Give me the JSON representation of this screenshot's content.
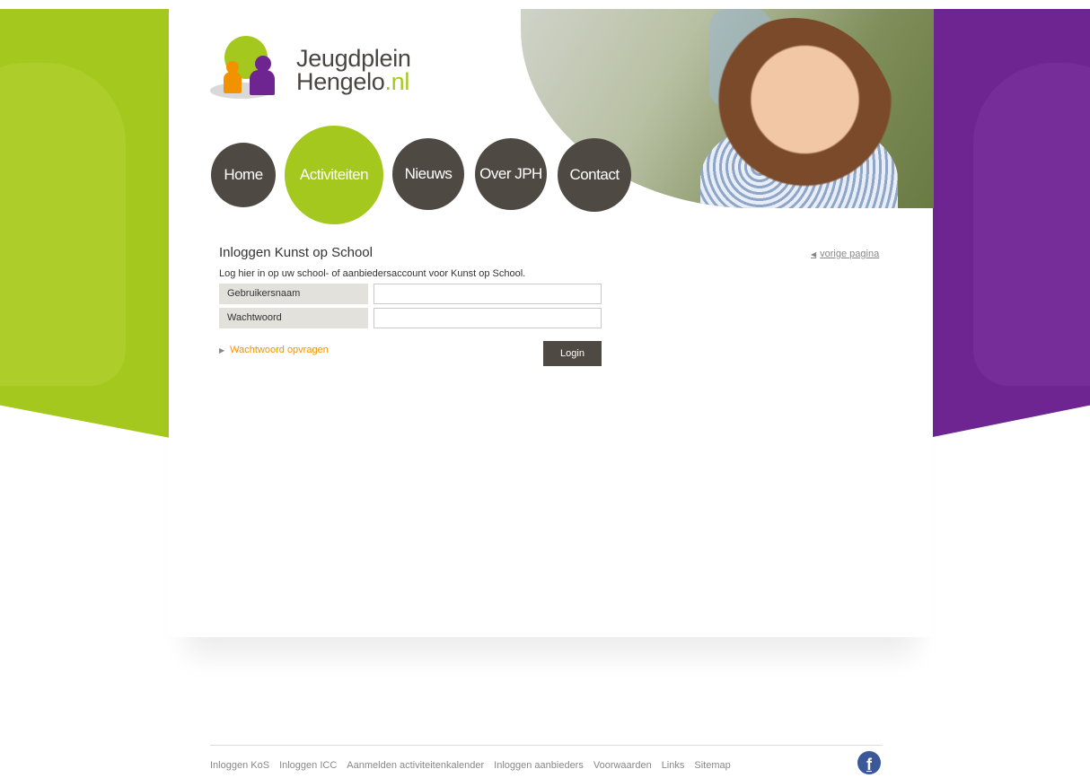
{
  "brand": {
    "line1": "Jeugdplein",
    "line2_main": "Hengelo",
    "line2_suffix": ".nl",
    "colors": {
      "green": "#a5c81e",
      "purple": "#6e2592",
      "dark": "#4f4944",
      "orange": "#f39200"
    }
  },
  "nav": {
    "items": [
      {
        "label": "Home",
        "active": false
      },
      {
        "label": "Activiteiten",
        "active": true
      },
      {
        "label": "Nieuws",
        "active": false
      },
      {
        "label": "Over JPH",
        "active": false
      },
      {
        "label": "Contact",
        "active": false
      }
    ]
  },
  "page": {
    "title": "Inloggen Kunst op School",
    "back_link": "vorige pagina",
    "intro": "Log hier in op uw school- of aanbiedersaccount voor Kunst op School."
  },
  "form": {
    "username_label": "Gebruikersnaam",
    "username_value": "",
    "password_label": "Wachtwoord",
    "password_value": "",
    "forgot_link": "Wachtwoord opvragen",
    "submit_label": "Login"
  },
  "footer": {
    "links": [
      "Inloggen KoS",
      "Inloggen ICC",
      "Aanmelden activiteitenkalender",
      "Inloggen aanbieders",
      "Voorwaarden",
      "Links",
      "Sitemap"
    ],
    "social_icon": "facebook-icon",
    "social_glyph": "f"
  }
}
